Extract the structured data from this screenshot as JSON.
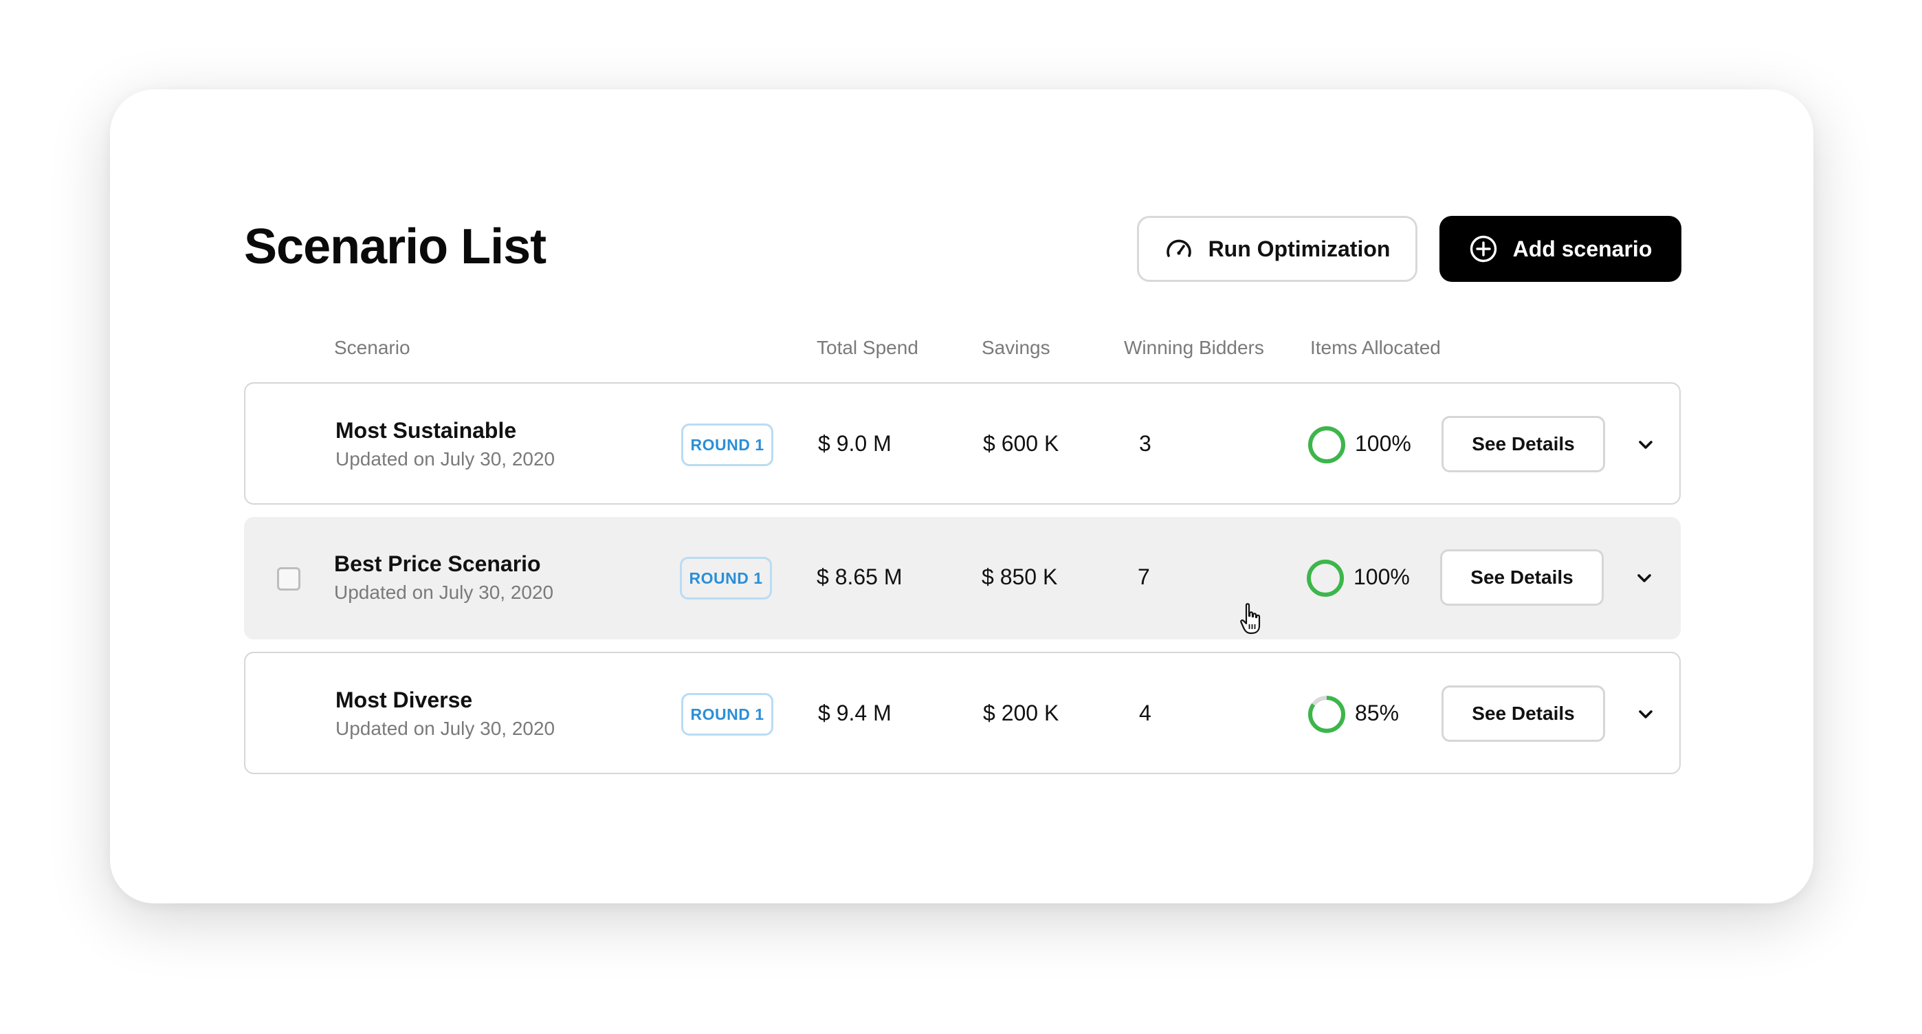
{
  "page": {
    "title": "Scenario List"
  },
  "toolbar": {
    "run_label": "Run Optimization",
    "run_icon": "speedometer-icon",
    "add_label": "Add scenario",
    "add_icon": "plus-circle-icon"
  },
  "columns": {
    "scenario": "Scenario",
    "total_spend": "Total Spend",
    "savings": "Savings",
    "winning_bidders": "Winning Bidders",
    "items_allocated": "Items Allocated"
  },
  "rows": [
    {
      "name": "Most Sustainable",
      "updated": "Updated on July 30, 2020",
      "badge": "ROUND 1",
      "total_spend": "$ 9.0 M",
      "savings": "$ 600 K",
      "winning_bidders": "3",
      "items_allocated_pct": "100%",
      "items_allocated_fraction": 1.0,
      "details_label": "See Details"
    },
    {
      "name": "Best Price Scenario",
      "updated": "Updated on July 30, 2020",
      "badge": "ROUND 1",
      "total_spend": "$ 8.65 M",
      "savings": "$ 850 K",
      "winning_bidders": "7",
      "items_allocated_pct": "100%",
      "items_allocated_fraction": 1.0,
      "details_label": "See Details"
    },
    {
      "name": "Most Diverse",
      "updated": "Updated on July 30, 2020",
      "badge": "ROUND 1",
      "total_spend": "$ 9.4 M",
      "savings": "$ 200 K",
      "winning_bidders": "4",
      "items_allocated_pct": "85%",
      "items_allocated_fraction": 0.85,
      "details_label": "See Details"
    }
  ],
  "colors": {
    "progress": "#3cb64a",
    "progress_track": "#d9d9d9",
    "badge": "#2b8fd8",
    "primary_button": "#000000"
  }
}
